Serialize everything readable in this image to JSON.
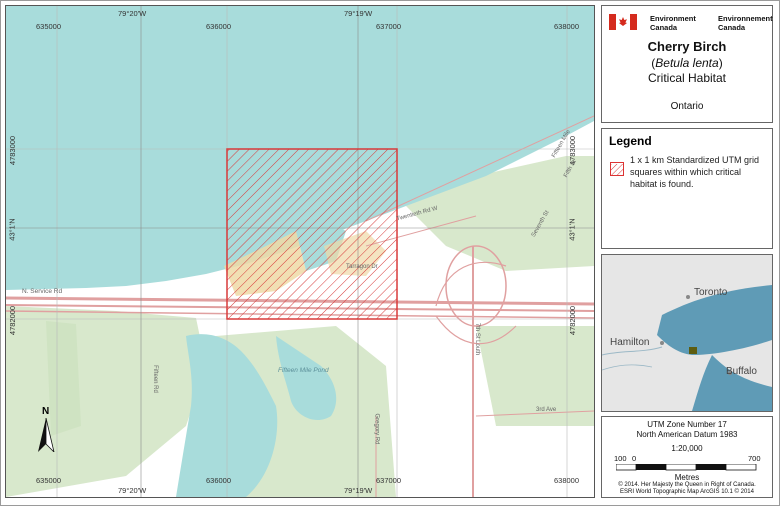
{
  "map": {
    "top_lon_labels": [
      "79°20'W",
      "79°19'W"
    ],
    "bottom_lon_labels": [
      "79°20'W",
      "79°19'W"
    ],
    "top_easting": [
      "635000",
      "636000",
      "637000",
      "638000"
    ],
    "bottom_easting": [
      "635000",
      "636000",
      "637000",
      "638000"
    ],
    "left_northing": [
      "4783000",
      "4782000"
    ],
    "right_northing": [
      "4783000",
      "4782000"
    ],
    "left_lat_label": "43°1'N",
    "right_lat_label": "43°1'N",
    "place_labels": {
      "road_n_service": "N. Service Rd",
      "pond": "Fifteen Mile Pond",
      "road_3rd": "3rd Ave",
      "road_7th": "7th St Louth",
      "road_fifteen": "Fifteen Mile",
      "road_fifth": "Fifth St",
      "road_seventh": "Seventh St",
      "road_tarragon": "Tarragon Dr",
      "road_twentieth": "Twentieth Rd W",
      "road_gregory": "Gregory Rd",
      "road_fifteen_rd": "Fifteen Rd"
    },
    "north_label": "N",
    "colors": {
      "water": "#a8dcdb",
      "land": "#ffffff",
      "forest": "#d8e8cc",
      "habitat": "#d83a3a",
      "road": "#e0a0a0",
      "wetland": "#efd9a6"
    }
  },
  "title_panel": {
    "agency_en_line1": "Environment",
    "agency_en_line2": "Canada",
    "agency_fr_line1": "Environnement",
    "agency_fr_line2": "Canada",
    "species_common": "Cherry Birch",
    "species_latin_open": "(",
    "species_latin": "Betula lenta",
    "species_latin_close": ")",
    "habitat_label": "Critical Habitat",
    "province": "Ontario"
  },
  "legend": {
    "heading": "Legend",
    "item_text": "1 x 1 km Standardized UTM grid squares within which critical habitat is found."
  },
  "inset": {
    "cities": [
      "Toronto",
      "Hamilton",
      "Buffalo"
    ],
    "colors": {
      "water": "#5f9bb6",
      "land": "#e6e6e6",
      "marker": "#5d5d10"
    }
  },
  "info": {
    "utm_zone": "UTM Zone Number 17",
    "datum": "North American Datum 1983",
    "scale": "1:20,000",
    "scale_ticks": [
      "100",
      "0",
      "700"
    ],
    "units": "Metres",
    "copyright1": "© 2014. Her Majesty the Queen in Right of Canada.",
    "copyright2": "ESRI World Topographic Map ArcGIS 10.1 © 2014"
  }
}
